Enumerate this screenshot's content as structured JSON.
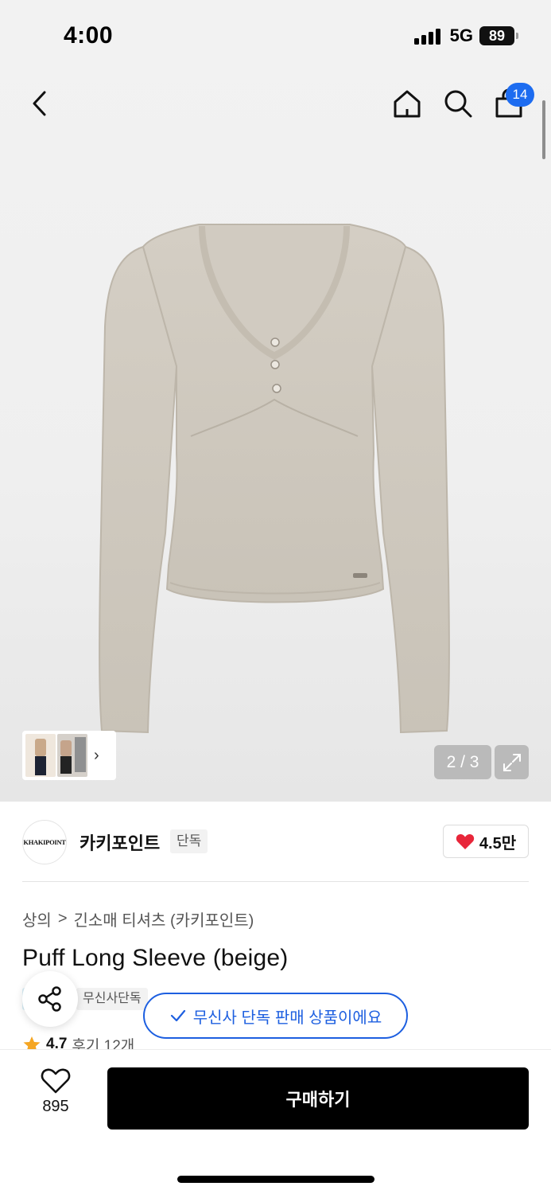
{
  "status_bar": {
    "time": "4:00",
    "network": "5G",
    "battery": "89"
  },
  "top_nav": {
    "cart_count": "14"
  },
  "gallery": {
    "page_counter": "2 / 3"
  },
  "brand": {
    "logo_text": "KHAKIPOINT",
    "name": "카키포인트",
    "tag": "단독",
    "likes": "4.5만"
  },
  "breadcrumb": {
    "items": [
      "상의",
      "긴소매 티셔츠 (카키포인트)"
    ],
    "separator": ">"
  },
  "product": {
    "title": "Puff Long Sleeve (beige)",
    "tag": "무신사단독",
    "rating": "4.7",
    "reviews": "후기 12개"
  },
  "toast": {
    "text": "무신사 단독 판매 상품이에요"
  },
  "bottom_bar": {
    "wish_count": "895",
    "buy_label": "구매하기"
  },
  "colors": {
    "accent_blue": "#1d5fe0",
    "badge_blue": "#1d6cf0",
    "heart_red": "#e8263a",
    "star_orange": "#f5a623",
    "garment_beige": "#cfc9be"
  }
}
